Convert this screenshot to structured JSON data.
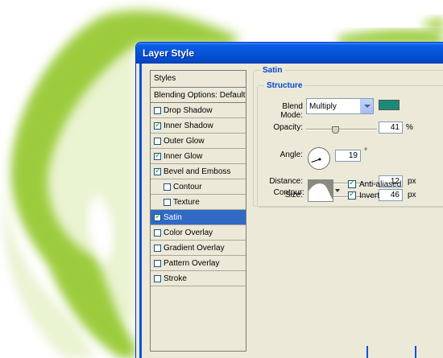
{
  "window": {
    "title": "Layer Style"
  },
  "styles_panel": {
    "header": "Styles",
    "blending_options": "Blending Options: Default",
    "items": [
      {
        "label": "Drop Shadow",
        "checked": false,
        "sub": false,
        "selected": false
      },
      {
        "label": "Inner Shadow",
        "checked": true,
        "sub": false,
        "selected": false
      },
      {
        "label": "Outer Glow",
        "checked": false,
        "sub": false,
        "selected": false
      },
      {
        "label": "Inner Glow",
        "checked": true,
        "sub": false,
        "selected": false
      },
      {
        "label": "Bevel and Emboss",
        "checked": true,
        "sub": false,
        "selected": false
      },
      {
        "label": "Contour",
        "checked": false,
        "sub": true,
        "selected": false
      },
      {
        "label": "Texture",
        "checked": false,
        "sub": true,
        "selected": false
      },
      {
        "label": "Satin",
        "checked": true,
        "sub": false,
        "selected": true
      },
      {
        "label": "Color Overlay",
        "checked": false,
        "sub": false,
        "selected": false
      },
      {
        "label": "Gradient Overlay",
        "checked": false,
        "sub": false,
        "selected": false
      },
      {
        "label": "Pattern Overlay",
        "checked": false,
        "sub": false,
        "selected": false
      },
      {
        "label": "Stroke",
        "checked": false,
        "sub": false,
        "selected": false
      }
    ]
  },
  "satin": {
    "group_label": "Satin",
    "structure_label": "Structure",
    "blend_mode_label": "Blend Mode:",
    "blend_mode_value": "Multiply",
    "color": "#1a8a78",
    "opacity_label": "Opacity:",
    "opacity_value": "41",
    "opacity_unit": "%",
    "opacity_fraction": 0.41,
    "angle_label": "Angle:",
    "angle_value": "19",
    "angle_unit": "°",
    "distance_label": "Distance:",
    "distance_value": "12",
    "distance_unit": "px",
    "distance_fraction": 0.05,
    "size_label": "Size:",
    "size_value": "46",
    "size_unit": "px",
    "size_fraction": 0.18,
    "contour_label": "Contour:",
    "anti_aliased_label": "Anti-aliased",
    "anti_aliased_checked": true,
    "invert_label": "Invert",
    "invert_checked": true
  },
  "icons": {
    "checkmark": "✓",
    "dropdown": "chevron-down-icon"
  },
  "colors": {
    "title_bar": "#0653d8",
    "selection": "#316ac5",
    "canvas_shape": "#9ccc3c",
    "group_label": "#0046d5"
  }
}
